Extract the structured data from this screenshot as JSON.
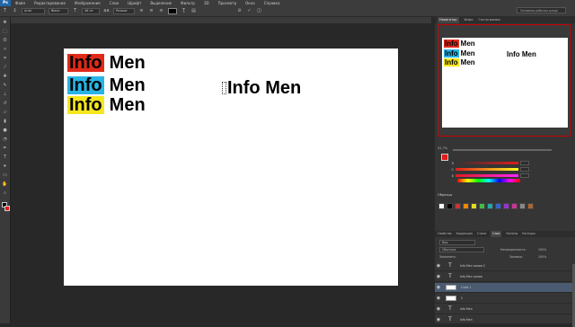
{
  "app": {
    "logo": "Ps"
  },
  "menu": [
    "Файл",
    "Редактирование",
    "Изображение",
    "Слои",
    "Шрифт",
    "Выделение",
    "Фильтр",
    "3D",
    "Просмотр",
    "Окно",
    "Справка"
  ],
  "options": {
    "font_family": "Arial",
    "font_style": "Black",
    "font_size": "48 пт",
    "aa_label": "aa",
    "aa_mode": "Резкое",
    "text_color": "#000000",
    "workspace": "Основная рабочая среда"
  },
  "canvas": {
    "rows": [
      {
        "tag": "Info",
        "tag_color": "#e02b1b",
        "word": "Men"
      },
      {
        "tag": "Info",
        "tag_color": "#28b4e6",
        "word": "Men"
      },
      {
        "tag": "Info",
        "tag_color": "#f5e61e",
        "word": "Men"
      }
    ],
    "big_text": "Info Men"
  },
  "navigator": {
    "tabs": [
      "Навигатор",
      "Инфо",
      "Гистограмма"
    ],
    "zoom": "41,7%"
  },
  "color": {
    "r": "255",
    "g": "0",
    "b": "0",
    "r_grad": "#e21b1b",
    "g_grad": "#f26",
    "b_grad": "#f20"
  },
  "swatches_tab": "Образцы",
  "layers_panel": {
    "tabs": [
      "Свойства",
      "Коррекция",
      "Стили",
      "Слои",
      "Каналы",
      "Контуры"
    ],
    "kind": "Вид",
    "blend": "Обычные",
    "opacity_label": "Непрозрачность:",
    "opacity": "100%",
    "lock_label": "Закрепить:",
    "fill_label": "Заливка:",
    "fill": "100%",
    "layers": [
      {
        "type": "T",
        "name": "Info Men копия 2",
        "selected": false
      },
      {
        "type": "T",
        "name": "Info Men копия",
        "selected": false
      },
      {
        "type": "shape",
        "name": "Слой 1",
        "selected": true
      },
      {
        "type": "shape",
        "name": "2",
        "selected": false
      },
      {
        "type": "T",
        "name": "info Men",
        "selected": false
      },
      {
        "type": "T",
        "name": "Info Men",
        "selected": false
      }
    ]
  }
}
